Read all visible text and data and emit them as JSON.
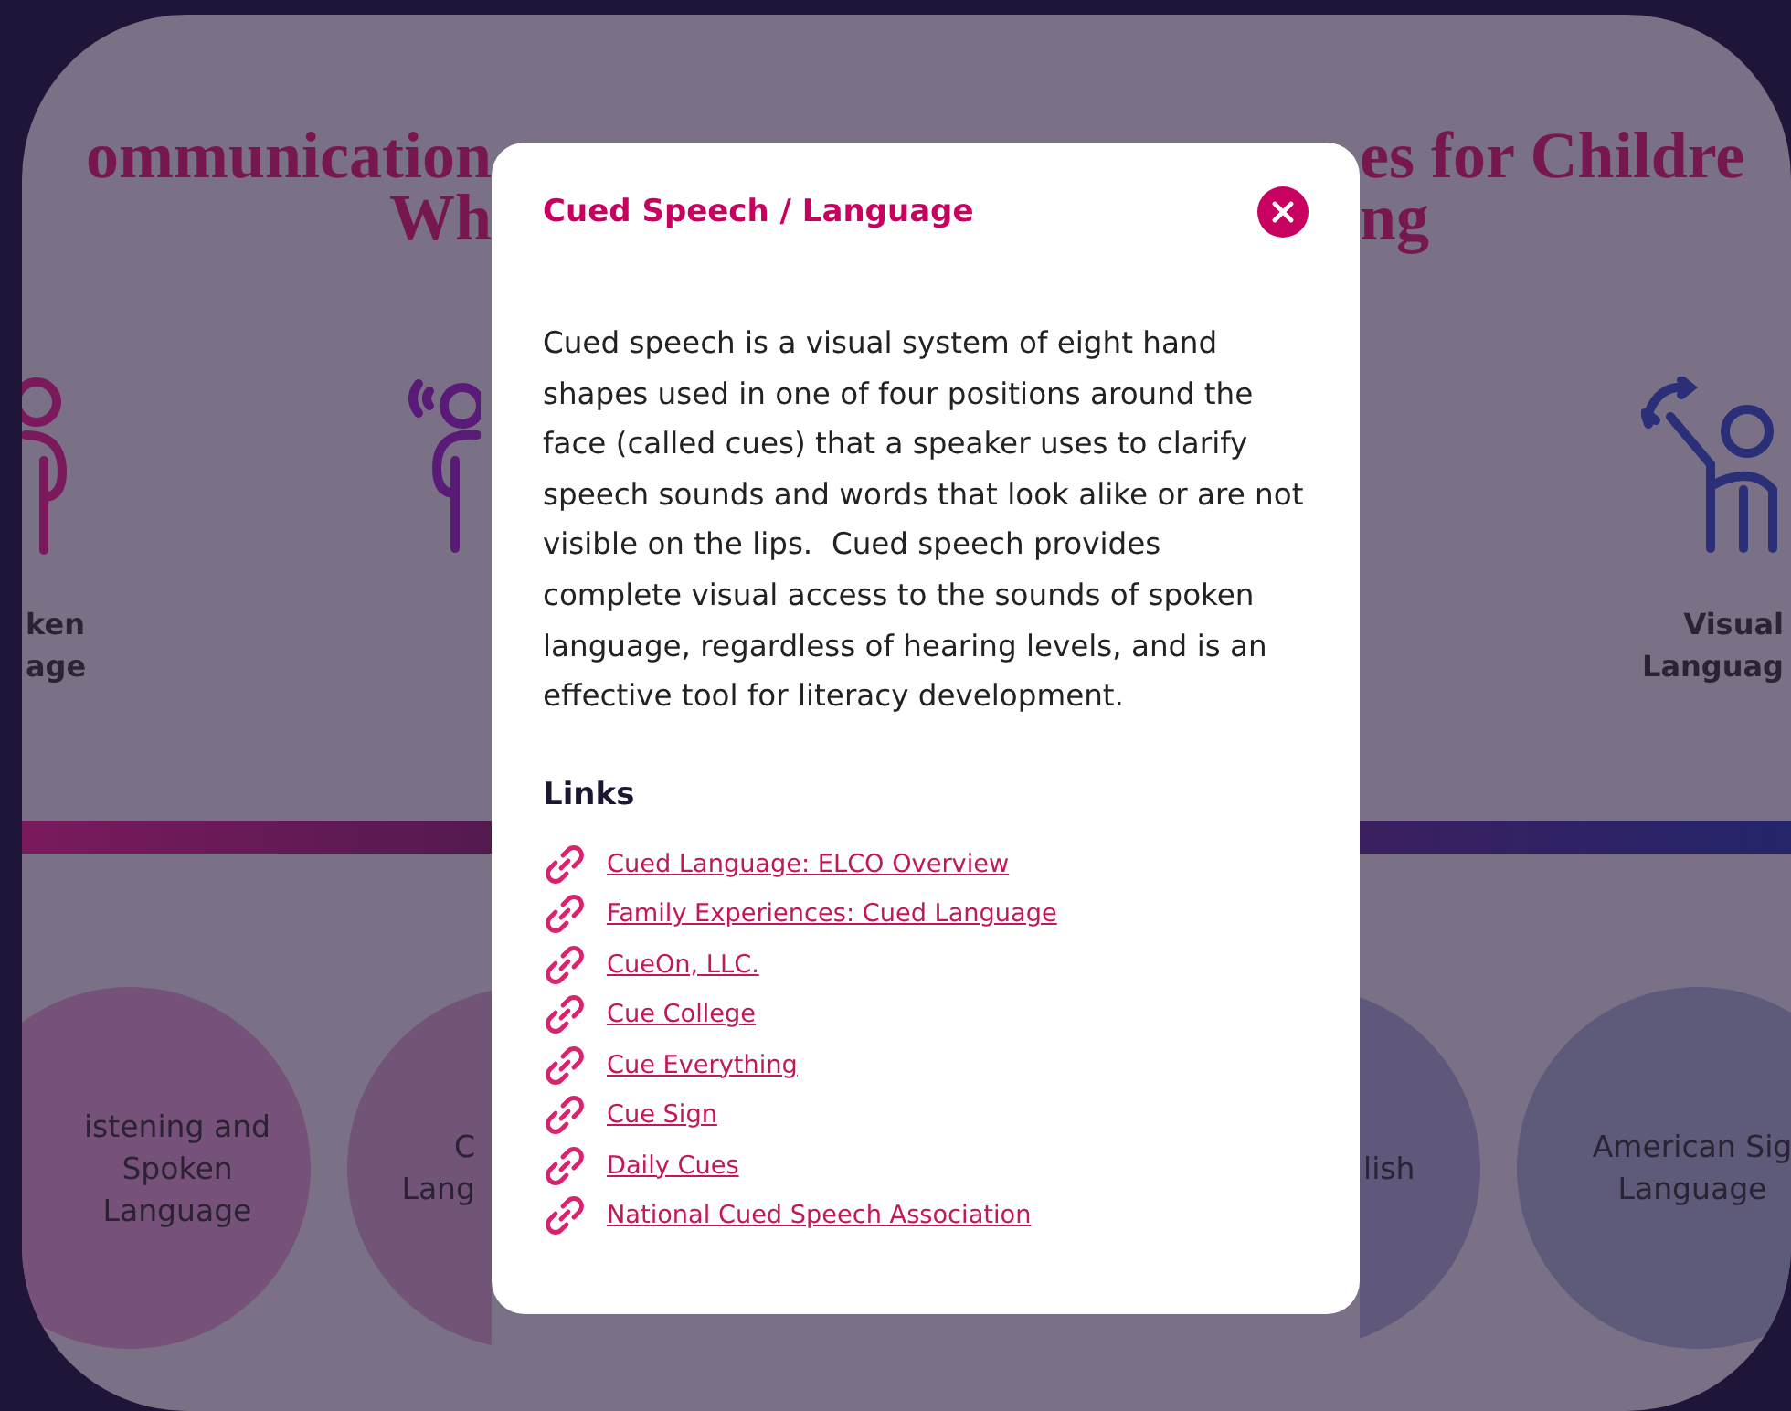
{
  "background": {
    "title_left": [
      "ommunication",
      "Wh"
    ],
    "title_right": [
      "es for Childre",
      "ng"
    ],
    "left_label": [
      "ken",
      "age"
    ],
    "right_label": [
      "Visual",
      "Languag"
    ],
    "circles_left": [
      {
        "lines": [
          "istening and",
          "Spoken",
          "Language"
        ]
      },
      {
        "lines": [
          "C",
          "Lang"
        ]
      }
    ],
    "circles_right": [
      {
        "lines": [
          "lish"
        ]
      },
      {
        "lines": [
          "American Sig",
          "Language"
        ]
      }
    ]
  },
  "modal": {
    "title": "Cued Speech / Language",
    "description": "Cued speech is a visual system of eight hand shapes used in one of four positions around the face (called cues) that a speaker uses to clarify speech sounds and words that look alike or are not visible on the lips.  Cued speech provides complete visual access to the sounds of spoken language, regardless of hearing levels, and is an effective tool for literacy development.",
    "links_heading": "Links",
    "links": [
      "Cued Language: ELCO Overview",
      "Family Experiences: Cued Language",
      "CueOn, LLC.",
      "Cue College",
      "Cue Everything",
      "Cue Sign",
      "Daily Cues",
      "National Cued Speech Association"
    ]
  }
}
